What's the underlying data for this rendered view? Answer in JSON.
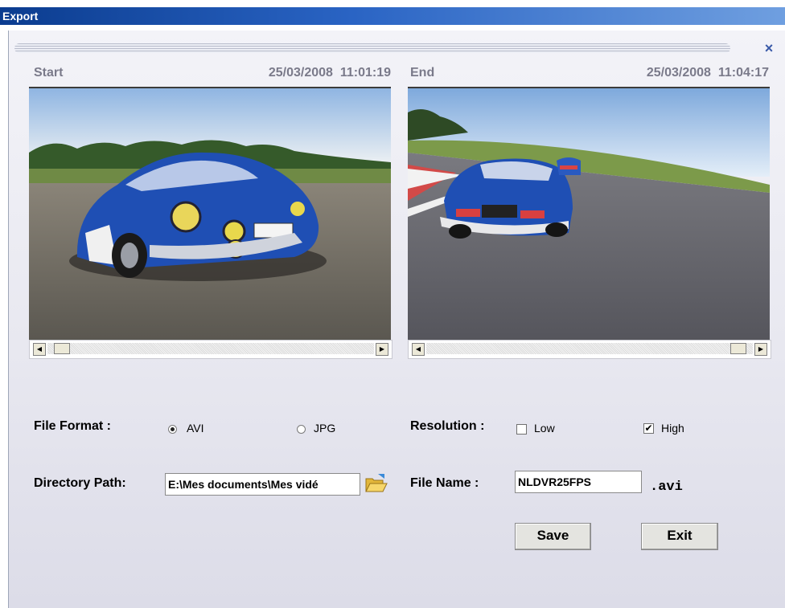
{
  "window": {
    "title": "Export",
    "close_glyph": "×"
  },
  "start": {
    "label": "Start",
    "date": "25/03/2008",
    "time": "11:01:19",
    "scroll_position": 0.02
  },
  "end": {
    "label": "End",
    "date": "25/03/2008",
    "time": "11:04:17",
    "scroll_position": 0.98
  },
  "file_format": {
    "label": "File Format :",
    "options": [
      {
        "label": "AVI",
        "selected": true
      },
      {
        "label": "JPG",
        "selected": false
      }
    ]
  },
  "resolution": {
    "label": "Resolution :",
    "options": [
      {
        "label": "Low",
        "checked": false
      },
      {
        "label": "High",
        "checked": true
      }
    ]
  },
  "directory": {
    "label": "Directory Path:",
    "value": "E:\\Mes documents\\Mes vidé",
    "icon": "folder-open-icon"
  },
  "file_name": {
    "label": "File Name :",
    "value": "NLDVR25FPS",
    "extension": ".avi"
  },
  "buttons": {
    "save": "Save",
    "exit": "Exit"
  },
  "colors": {
    "title_bar": "#0b3c8f",
    "car_blue": "#1f4fb4"
  }
}
